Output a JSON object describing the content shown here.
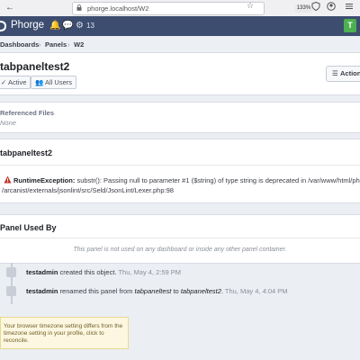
{
  "browser": {
    "url": "phorge.localhost/W2",
    "zoom": "133%",
    "icons": [
      "back-arrow-icon",
      "lock-icon",
      "bookmark-icon",
      "shield-icon",
      "account-icon",
      "menu-icon"
    ]
  },
  "app": {
    "name": "Phorge",
    "notification_count": "13",
    "avatar_letter": "T",
    "colors": {
      "header_bg": "#3d4d70",
      "avatar_bg": "#4caf50"
    }
  },
  "breadcrumbs": [
    "Dashboards",
    "Panels",
    "W2"
  ],
  "header": {
    "title": "tabpaneltest2",
    "status": "Active",
    "visibility": "All Users",
    "actions_label": "Actions"
  },
  "referenced_files": {
    "title": "Referenced Files",
    "value": "None"
  },
  "error_panel": {
    "title": "tabpaneltest2",
    "error_type": "RuntimeException:",
    "message_line1": "substr(): Passing null to parameter #1 ($string) of type string is deprecated in /var/www/html/phorge",
    "message_line2": "/arcanist/externals/jsonlint/src/Seld/JsonLint/Lexer.php:98"
  },
  "panel_used_by": {
    "title": "Panel Used By",
    "empty_text": "This panel is not used on any dashboard or inside any other panel container."
  },
  "timeline": [
    {
      "user": "testadmin",
      "pre": "created this object.",
      "time": "Thu, May 4, 2:59 PM"
    },
    {
      "user": "testadmin",
      "pre": "renamed this panel from",
      "old_name": "tabpaneltest",
      "mid": "to",
      "new_name": "tabpaneltest2",
      "end": ".",
      "time": "Thu, May 4, 4:04 PM"
    }
  ],
  "timezone_notice": {
    "line1": "Your browser timezone setting differs from the",
    "line2": "timezone setting in your profile, click to",
    "line3": "reconcile."
  }
}
